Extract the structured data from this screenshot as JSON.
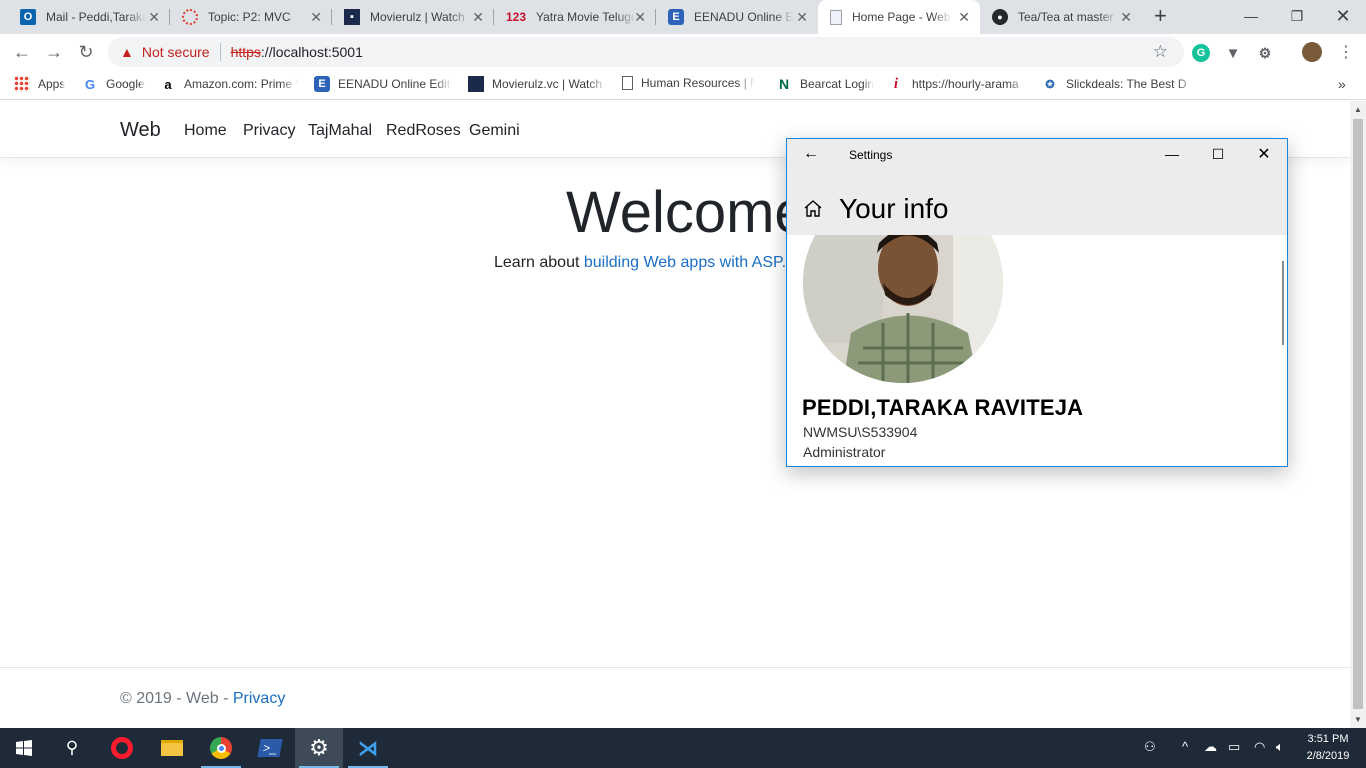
{
  "browser": {
    "tabs": [
      {
        "title": "Mail - Peddi,Taraka",
        "favicon": "outlook-icon"
      },
      {
        "title": "Topic: P2: MVC",
        "favicon": "canvas-icon"
      },
      {
        "title": "Movierulz | Watch",
        "favicon": "movierulz-icon"
      },
      {
        "title": "Yatra Movie Telugu",
        "favicon": "123-icon"
      },
      {
        "title": "EENADU Online Ed",
        "favicon": "eenadu-icon"
      },
      {
        "title": "Home Page - Web",
        "favicon": "page-icon"
      },
      {
        "title": "Tea/Tea at master",
        "favicon": "github-icon"
      }
    ],
    "address": {
      "warning": "Not secure",
      "scheme": "https",
      "rest": "://localhost:5001"
    },
    "bookmarks": [
      {
        "label": "Apps",
        "icon": "apps-grid-icon"
      },
      {
        "label": "Google",
        "icon": "google-icon"
      },
      {
        "label": "Amazon.com: Prime V",
        "icon": "amazon-icon"
      },
      {
        "label": "EENADU Online Editi",
        "icon": "eenadu-icon"
      },
      {
        "label": "Movierulz.vc | Watch",
        "icon": "movierulz-icon"
      },
      {
        "label": "Human Resources | N",
        "icon": "page-icon"
      },
      {
        "label": "Bearcat Login",
        "icon": "bearcat-icon"
      },
      {
        "label": "https://hourly-arama",
        "icon": "info-icon"
      },
      {
        "label": "Slickdeals: The Best D",
        "icon": "slickdeals-icon"
      }
    ],
    "more_bookmarks": "»"
  },
  "web": {
    "brand": "Web",
    "nav": [
      "Home",
      "Privacy",
      "TajMahal",
      "RedRoses",
      "Gemini"
    ],
    "heading": "Welcome",
    "learn_prefix": "Learn about ",
    "learn_link": "building Web apps with ASP.",
    "footer_text": "© 2019 - Web - ",
    "footer_link": "Privacy"
  },
  "settings": {
    "window_title": "Settings",
    "page_title": "Your info",
    "user_name": "PEDDI,TARAKA RAVITEJA",
    "account": "NWMSU\\S533904",
    "role": "Administrator"
  },
  "taskbar": {
    "time": "3:51 PM",
    "date": "2/8/2019"
  },
  "colors": {
    "link": "#1b6ec2",
    "taskbar": "#1f2a38",
    "insecure": "#c5221f",
    "settings_border": "#1883d7"
  }
}
